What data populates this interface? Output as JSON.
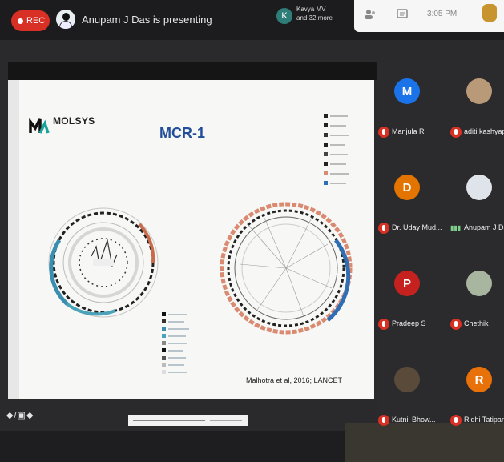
{
  "meeting": {
    "rec_label": "REC",
    "presenting_text": "Anupam J Das is presenting",
    "viewer_initial": "K",
    "viewer_line1": "Kavya MV",
    "viewer_line2": "and 32 more",
    "time": "3:05 PM"
  },
  "slide": {
    "logo_text": "MOLSYS",
    "title": "MCR-1",
    "citation": "Malhotra et al, 2016; LANCET"
  },
  "participants": [
    {
      "name": "Manjula R",
      "initial": "M",
      "color": "#1a73e8",
      "mic": "muted"
    },
    {
      "name": "aditi kashyap",
      "initial": "",
      "color": "#c9a87a",
      "mic": "muted"
    },
    {
      "name": "Dr. Uday Mud...",
      "initial": "D",
      "color": "#e37400",
      "mic": "muted"
    },
    {
      "name": "Anupam J Das",
      "initial": "",
      "color": "#e6e9ee",
      "mic": "speaking"
    },
    {
      "name": "Pradeep S",
      "initial": "P",
      "color": "#c5221f",
      "mic": "muted"
    },
    {
      "name": "Chethik",
      "initial": "",
      "color": "#a8b6a0",
      "mic": "muted"
    },
    {
      "name": "Kutnil Bhow...",
      "initial": "",
      "color": "#5a4a3a",
      "mic": "muted"
    },
    {
      "name": "Ridhi Tatipara",
      "initial": "R",
      "color": "#e8710a",
      "mic": "muted"
    }
  ],
  "icons": {
    "rec": "record-dot-icon",
    "people": "people-icon",
    "chat": "chat-icon",
    "activities": "activities-icon"
  }
}
